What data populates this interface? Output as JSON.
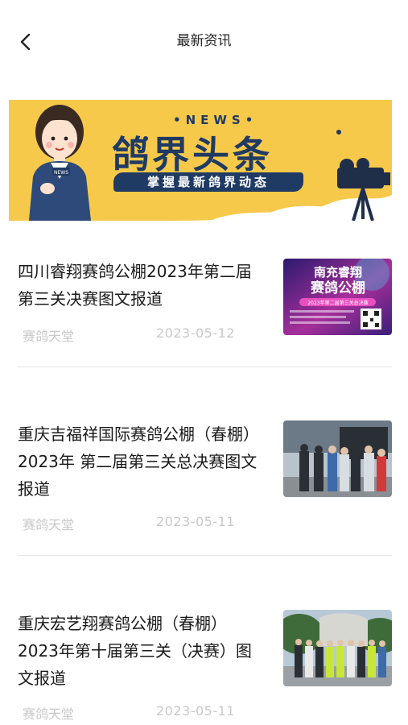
{
  "header": {
    "title": "最新资讯"
  },
  "banner": {
    "news_label": "•NEWS•",
    "headline": "鸽界头条",
    "slogan": "掌握最新鸽界动态",
    "mic_label": "NEWS"
  },
  "news": [
    {
      "title": "四川睿翔赛鸽公棚2023年第二届第三关决赛图文报道",
      "source": "赛鸽天堂",
      "date": "2023-05-12",
      "thumb": {
        "line1": "南充睿翔",
        "line2": "赛鸽公棚",
        "line3": "2023年第二届第三关总决赛",
        "colors": [
          "#2a1a6e",
          "#a72f9a",
          "#3ad0e8"
        ]
      }
    },
    {
      "title": "重庆吉福祥国际赛鸽公棚（春棚）2023年 第二届第三关总决赛图文报道",
      "source": "赛鸽天堂",
      "date": "2023-05-11",
      "thumb": {
        "colors": [
          "#6b7a86",
          "#2a2f36",
          "#b9c3cc"
        ]
      }
    },
    {
      "title": "重庆宏艺翔赛鸽公棚（春棚）2023年第十届第三关（决赛）图文报道",
      "source": "赛鸽天堂",
      "date": "2023-05-11",
      "thumb": {
        "colors": [
          "#b7c9d6",
          "#3f6b3a",
          "#d7d7d2"
        ]
      }
    }
  ]
}
